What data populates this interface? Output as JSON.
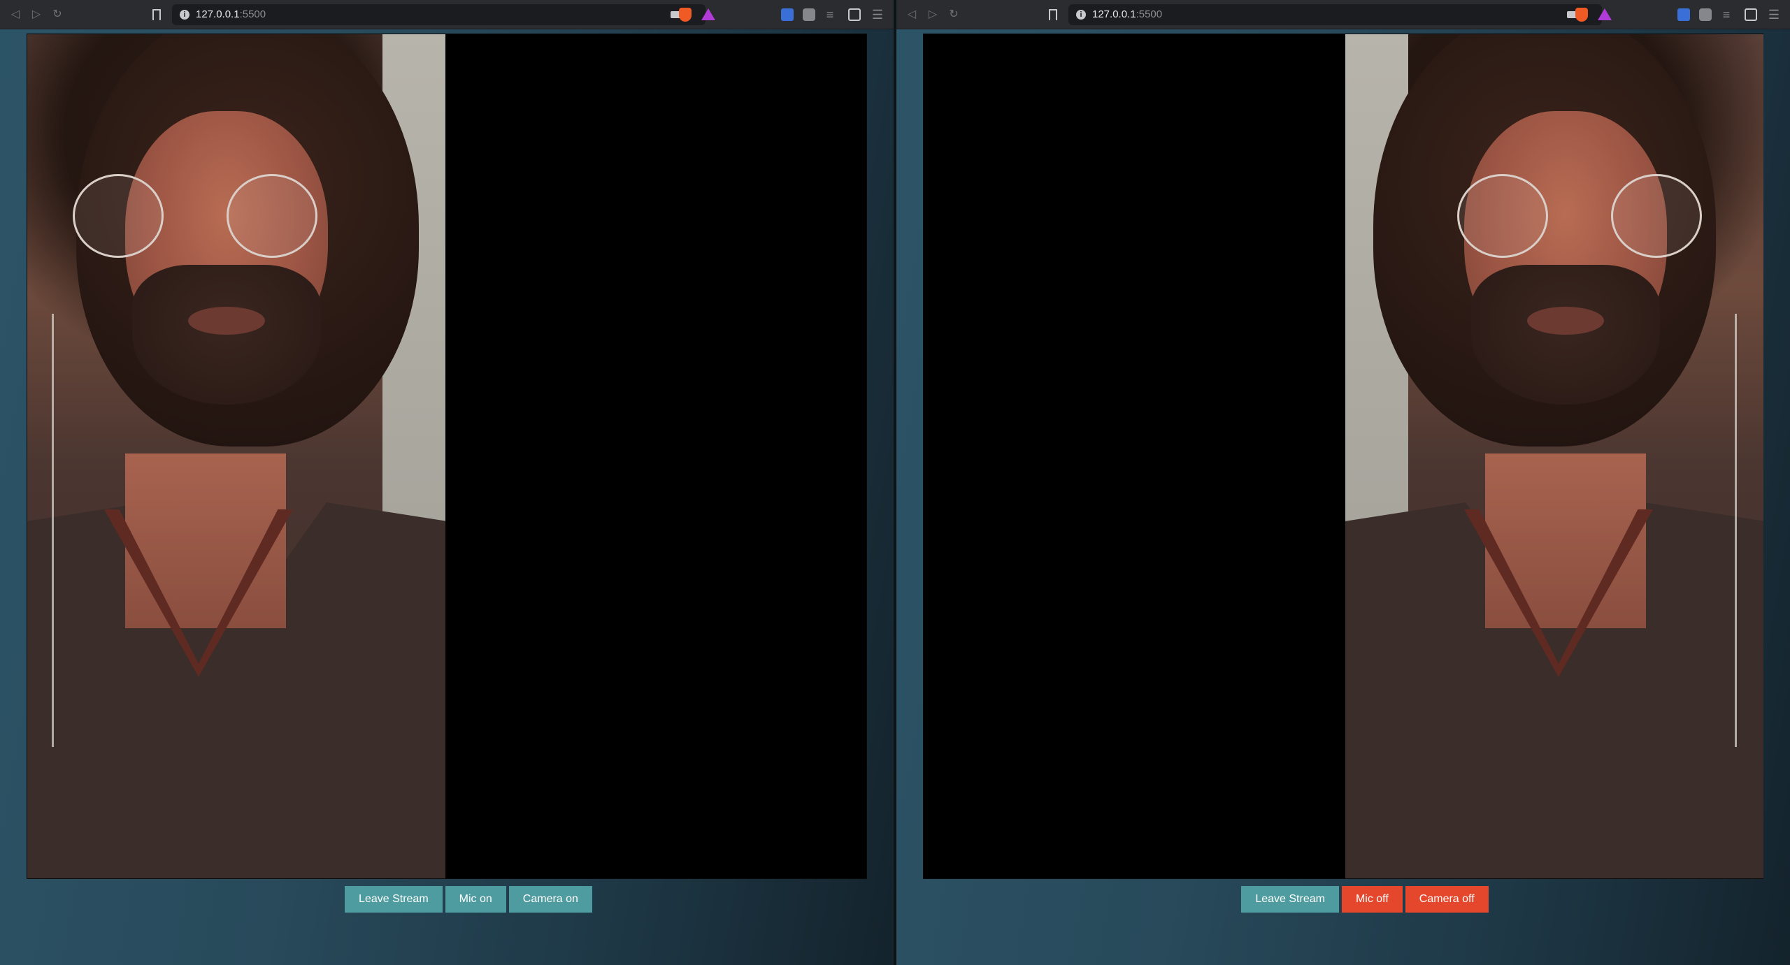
{
  "windows": [
    {
      "url": {
        "host": "127.0.0.1",
        "port": ":5500"
      },
      "controls": {
        "leave_label": "Leave Stream",
        "mic_label": "Mic on",
        "camera_label": "Camera on",
        "mic_state": "on",
        "camera_state": "on"
      },
      "feed_side": "left"
    },
    {
      "url": {
        "host": "127.0.0.1",
        "port": ":5500"
      },
      "controls": {
        "leave_label": "Leave Stream",
        "mic_label": "Mic off",
        "camera_label": "Camera off",
        "mic_state": "off",
        "camera_state": "off"
      },
      "feed_side": "right"
    }
  ],
  "colors": {
    "button_on": "#4e9ba0",
    "button_off": "#e4472b",
    "page_gradient_start": "#2c5467",
    "page_gradient_end": "#14232c"
  },
  "icons": {
    "toolbar": [
      "back-icon",
      "forward-icon",
      "reload-icon",
      "bookmark-icon",
      "site-info-icon",
      "camera-in-use-icon",
      "brave-shields-icon",
      "brave-rewards-icon",
      "bitwarden-icon",
      "extensions-icon",
      "playlist-icon",
      "wallet-icon",
      "menu-icon"
    ]
  }
}
